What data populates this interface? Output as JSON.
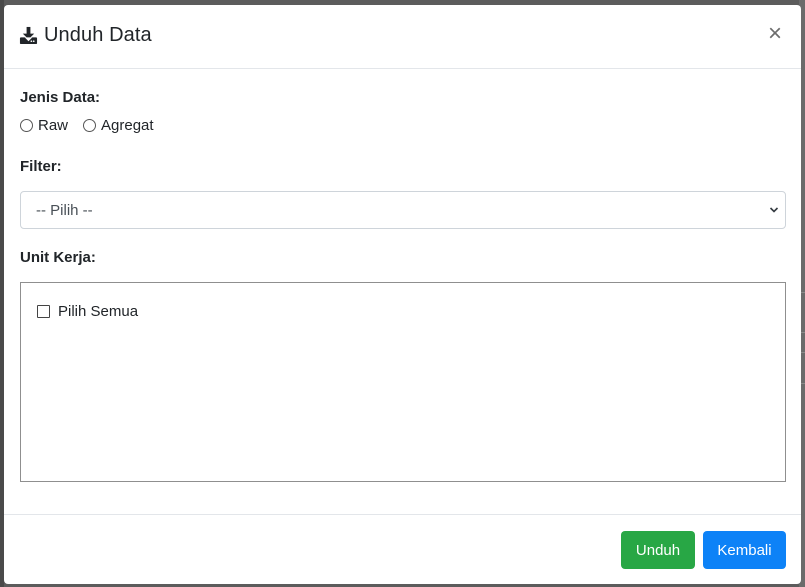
{
  "modal": {
    "title": "Unduh Data",
    "close_label": "×",
    "icon": "download-icon"
  },
  "form": {
    "jenis_data": {
      "label": "Jenis Data:",
      "options": [
        "Raw",
        "Agregat"
      ]
    },
    "filter": {
      "label": "Filter:",
      "selected": "-- Pilih --"
    },
    "unit_kerja": {
      "label": "Unit Kerja:",
      "select_all_label": "Pilih Semua"
    }
  },
  "footer": {
    "download_label": "Unduh",
    "back_label": "Kembali"
  },
  "colors": {
    "download_button": "#28a745",
    "back_button": "#0d82f7"
  }
}
